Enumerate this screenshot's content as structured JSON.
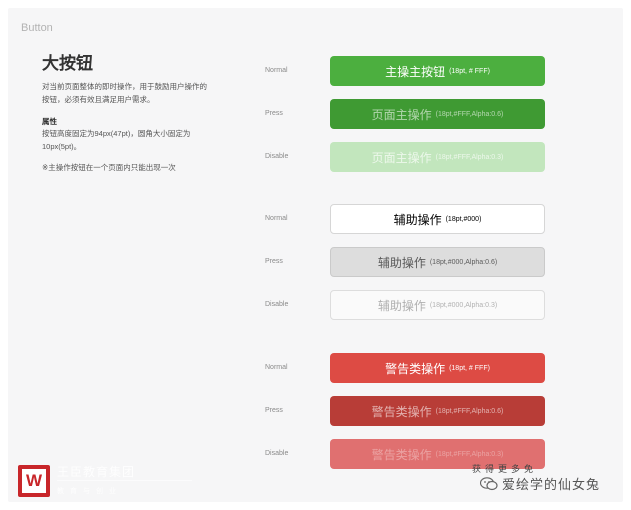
{
  "section_label": "Button",
  "heading": "大按钮",
  "description": "对当前页面整体的即时操作，用于鼓励用户操作的按钮，必须有效且满足用户需求。",
  "attr_title": "属性",
  "attr_text": "按钮高度固定为94px(47pt)，圆角大小固定为10px(5pt)。",
  "note": "※主操作按钮在一个页面内只能出现一次",
  "groups": [
    {
      "rows": [
        {
          "state": "Normal",
          "label": "主操主按钮",
          "spec": "(18pt, # FFF)"
        },
        {
          "state": "Press",
          "label": "页面主操作",
          "spec": "(18pt,#FFF,Alpha:0.6)"
        },
        {
          "state": "Disable",
          "label": "页面主操作",
          "spec": "(18pt,#FFF,Alpha:0.3)"
        }
      ]
    },
    {
      "rows": [
        {
          "state": "Normal",
          "label": "辅助操作",
          "spec": "(18pt,#000)"
        },
        {
          "state": "Press",
          "label": "辅助操作",
          "spec": "(18pt,#000,Alpha:0.6)"
        },
        {
          "state": "Disable",
          "label": "辅助操作",
          "spec": "(18pt,#000,Alpha:0.3)"
        }
      ]
    },
    {
      "rows": [
        {
          "state": "Normal",
          "label": "警告类操作",
          "spec": "(18pt, # FFF)"
        },
        {
          "state": "Press",
          "label": "警告类操作",
          "spec": "(18pt,#FFF,Alpha:0.6)"
        },
        {
          "state": "Disable",
          "label": "警告类操作",
          "spec": "(18pt,#FFF,Alpha:0.3)"
        }
      ]
    }
  ],
  "colors": {
    "primary": "#4caf3f",
    "primary_press": "#3f9a33",
    "primary_disabled": "#c2e6bd",
    "secondary_border": "#d6d6d6",
    "secondary_press": "#dddddd",
    "warning": "#dd4b44",
    "warning_press": "#b83d37",
    "warning_disabled": "#e07070"
  },
  "watermark": {
    "logo_letter": "W",
    "org_name": "王臣教育集团",
    "org_sub": "教育与创业",
    "promo_small": "获得更多免",
    "promo_text": "爱绘学的仙女兔",
    "promo_icon": "wechat-icon"
  }
}
